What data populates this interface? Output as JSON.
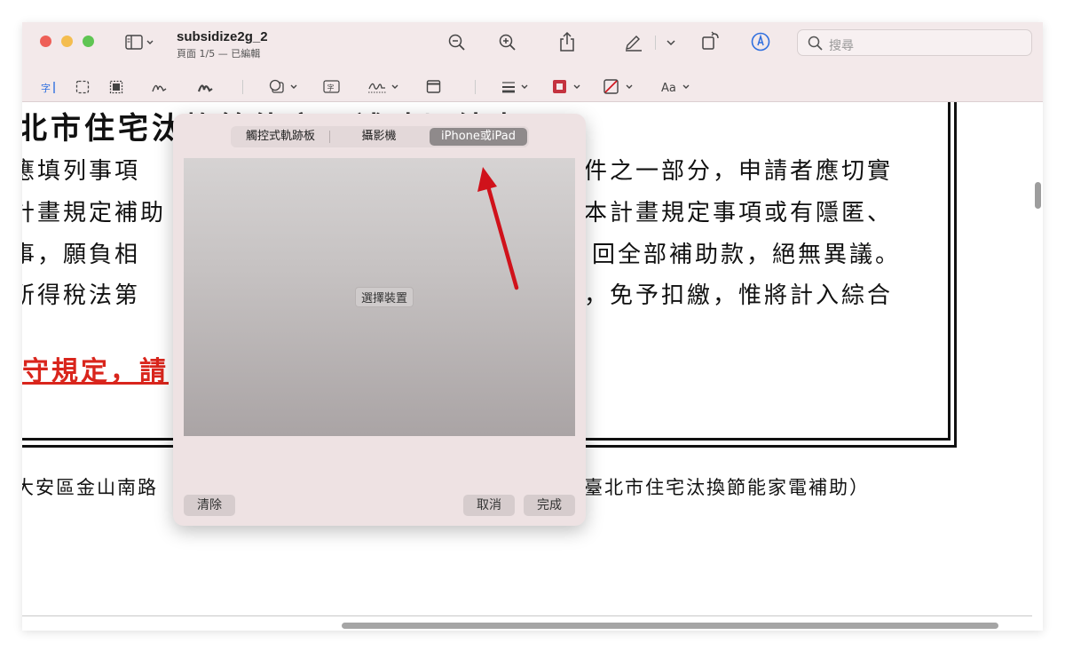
{
  "window": {
    "title": "subsidize2g_2",
    "subtitle": "頁面 1/5 — 已編輯",
    "search_placeholder": "搜尋"
  },
  "document": {
    "title_line": "北市住宅汰換節能家電補助切結書",
    "lines": [
      "應填列事項",
      "件之一部分，申請者應切實",
      "計畫規定補助",
      "本計畫規定事項或有隱匿、",
      "事，願負相",
      "回全部補助款，絕無異議。",
      "所得稅法第",
      "，免予扣繳，惟將計入綜合"
    ],
    "red_text": "守規定，請",
    "footer_left": "大安區金山南路",
    "footer_right": "臺北市住宅汰換節能家電補助）"
  },
  "signature_sheet": {
    "tabs": [
      "觸控式軌跡板",
      "攝影機",
      "iPhone或iPad"
    ],
    "selected_tab": "iPhone或iPad",
    "choose_device_label": "選擇裝置",
    "clear_label": "清除",
    "cancel_label": "取消",
    "done_label": "完成"
  },
  "colors": {
    "annotation_arrow": "#d0121b",
    "accent_blue": "#2f6fdf"
  }
}
